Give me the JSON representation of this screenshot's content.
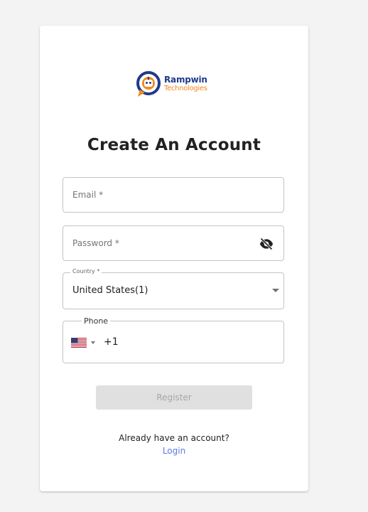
{
  "logo": {
    "name": "Rampwin",
    "subtitle": "Technologies",
    "icon": "robot-chat-bubble-icon"
  },
  "form": {
    "title": "Create An Account",
    "email_placeholder": "Email *",
    "password_placeholder": "Password *",
    "password_toggle_icon": "eye-off-icon",
    "country_label": "Country *",
    "country_value": "United States(1)",
    "phone_label": "Phone",
    "phone_flag": "us-flag-icon",
    "phone_dial_code": "+1",
    "register_label": "Register",
    "register_enabled": false
  },
  "footer": {
    "prompt": "Already have an account?",
    "login_label": "Login"
  },
  "colors": {
    "accent_blue": "#1f3a8a",
    "accent_orange": "#f08a1c",
    "link": "#5b7be0",
    "disabled_button": "#e0e0e0"
  }
}
